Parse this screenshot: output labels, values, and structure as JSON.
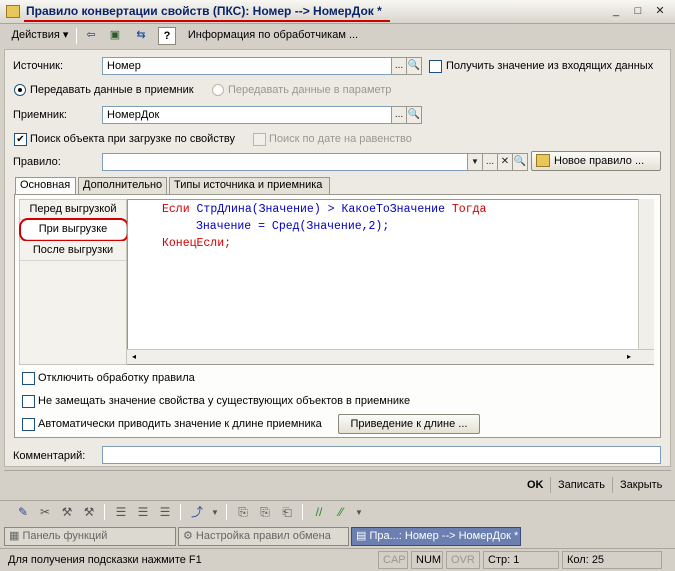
{
  "window": {
    "title": "Правило конвертации свойств (ПКС): Номер --> НомерДок *",
    "controls": {
      "minimize": "_",
      "restore": "□",
      "close": "✕"
    }
  },
  "toolbar": {
    "actions_label": "Действия",
    "handlers_info_label": "Информация по обработчикам ..."
  },
  "form": {
    "source_label": "Источник:",
    "source_value": "Номер",
    "get_from_input_label": "Получить значение из входящих данных",
    "pass_to_receiver_label": "Передавать данные в приемник",
    "pass_to_param_label": "Передавать данные в параметр",
    "receiver_label": "Приемник:",
    "receiver_value": "НомерДок",
    "search_object_label": "Поиск объекта при загрузке по свойству",
    "search_by_date_label": "Поиск по дате на равенство",
    "rule_label": "Правило:",
    "rule_value": "",
    "new_rule_label": "Новое правило ...",
    "ellipsis": "...",
    "search_glyph": "🔍",
    "clear_glyph": "✕",
    "dropdown_glyph": "▼"
  },
  "tabs": [
    {
      "label": "Основная"
    },
    {
      "label": "Дополнительно"
    },
    {
      "label": "Типы источника и приемника"
    }
  ],
  "events": [
    {
      "label": "Перед выгрузкой"
    },
    {
      "label": "При выгрузке"
    },
    {
      "label": "После выгрузки"
    }
  ],
  "code": {
    "line1": {
      "kw1": "Если",
      "id1": "СтрДлина(Значение)",
      "op": ">",
      "id2": "КакоеТоЗначение",
      "kw2": "Тогда"
    },
    "line2": {
      "text": "Значение = Сред(Значение,2);"
    },
    "line3": {
      "kw": "КонецЕсли;"
    }
  },
  "options": {
    "disable_processing_label": "Отключить обработку правила",
    "no_replace_label": "Не замещать значение свойства у существующих объектов в приемнике",
    "auto_length_label": "Автоматически приводить значение к длине приемника",
    "length_button_label": "Приведение к длине ..."
  },
  "comment": {
    "label": "Комментарий:",
    "value": ""
  },
  "footer": {
    "ok": "OK",
    "save": "Записать",
    "close": "Закрыть"
  },
  "taskbar": [
    {
      "label": "Панель функций"
    },
    {
      "label": "Настройка правил обмена"
    },
    {
      "label": "Пра...: Номер --> НомерДок *"
    }
  ],
  "status": {
    "hint": "Для получения подсказки нажмите F1",
    "cap": "CAP",
    "num": "NUM",
    "ovr": "OVR",
    "line": "Стр: 1",
    "col": "Кол: 25"
  },
  "colors": {
    "keyword": "#d00000",
    "identifier": "#0000c0",
    "highlight_ring": "#d00000"
  }
}
